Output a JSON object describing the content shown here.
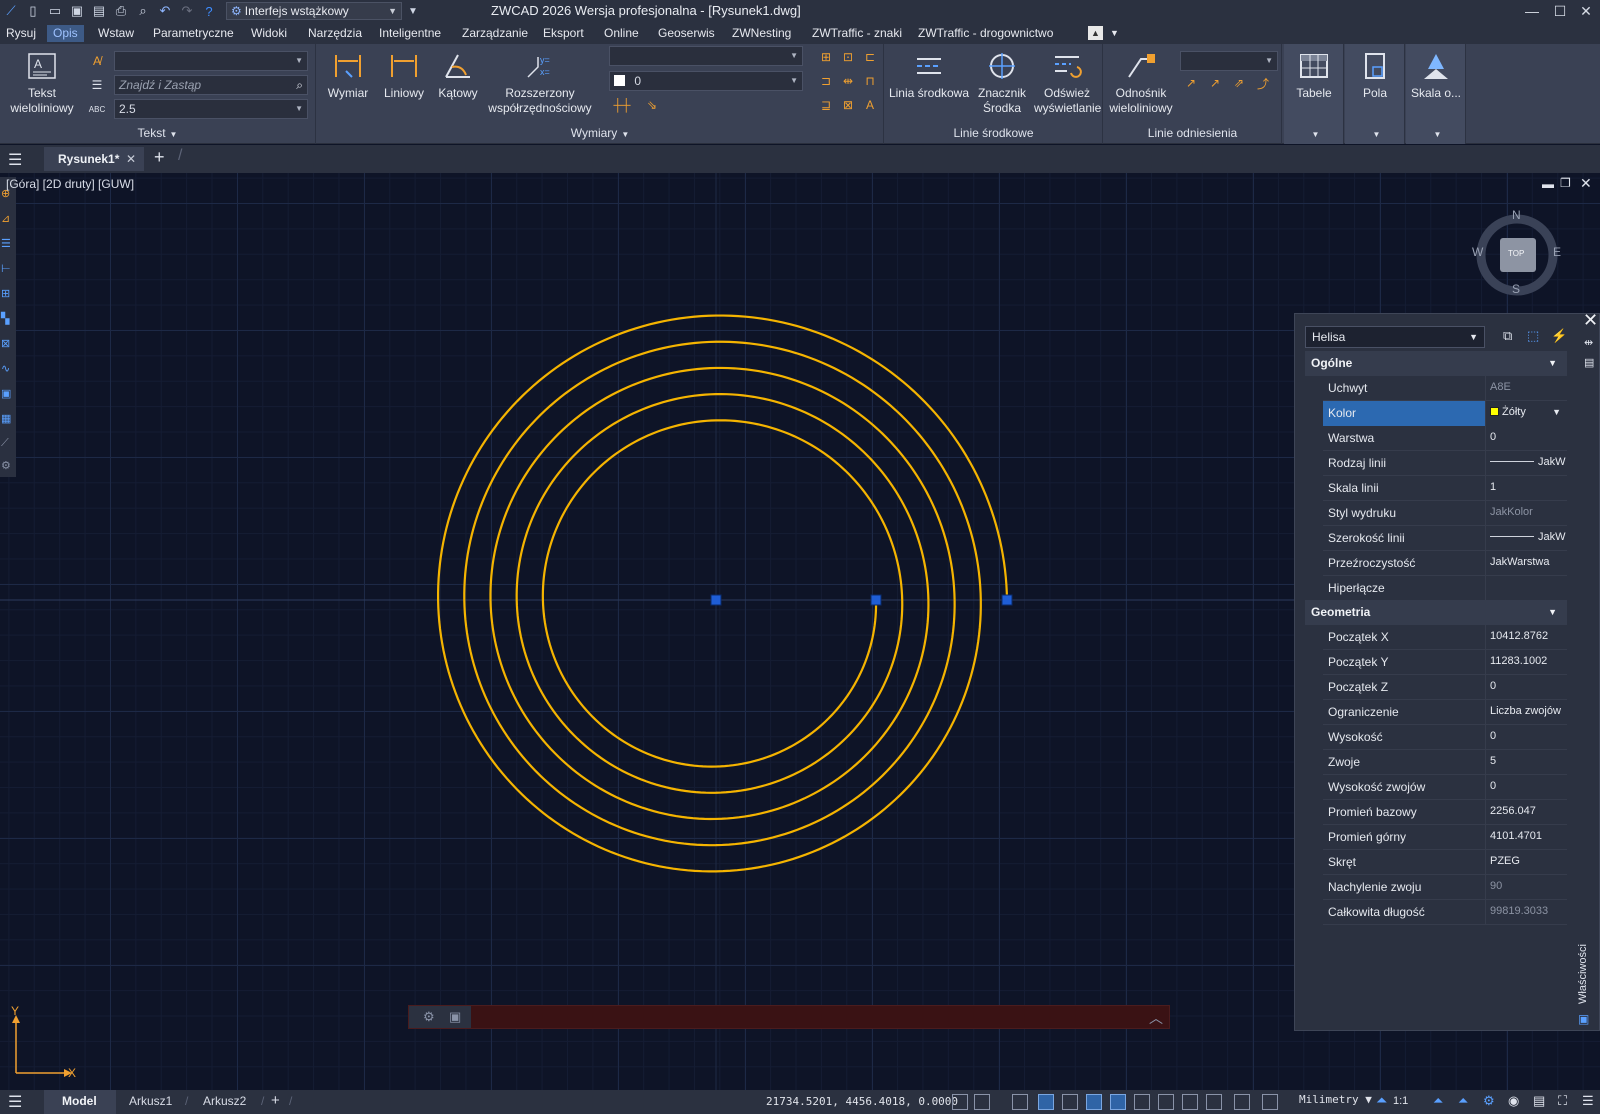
{
  "titlebar": {
    "workspace": "Interfejs wstążkowy",
    "title": "ZWCAD 2026 Wersja profesjonalna - [Rysunek1.dwg]"
  },
  "menu": [
    "Rysuj",
    "Opis",
    "Wstaw",
    "Parametryczne",
    "Widoki",
    "Narzędzia",
    "Inteligentne",
    "Zarządzanie",
    "Eksport",
    "Online",
    "Geoserwis",
    "ZWNesting",
    "ZWTraffic - znaki",
    "ZWTraffic - drogownictwo"
  ],
  "ribbon": {
    "text_panel": {
      "title": "Tekst",
      "mtext_label": "Tekst wieloliniowy",
      "find_placeholder": "Znajdź i Zastąp",
      "height_value": "2.5"
    },
    "dim_panel": {
      "title": "Wymiary",
      "buttons": [
        "Wymiar",
        "Liniowy",
        "Kątowy",
        "Rozszerzony współrzędnościowy"
      ],
      "layer_value": "0"
    },
    "center_panel": {
      "title": "Linie środkowe",
      "buttons": [
        "Linia środkowa",
        "Znacznik Środka",
        "Odśwież wyświetlanie"
      ]
    },
    "leader_panel": {
      "title": "Linie odniesienia",
      "button": "Odnośnik wieloliniowy"
    },
    "extra_buttons": [
      "Tabele",
      "Pola",
      "Skala o..."
    ]
  },
  "document_tab": "Rysunek1*",
  "viewport_label": "[Góra] [2D druty] [GUW]",
  "viewcube": {
    "n": "N",
    "s": "S",
    "e": "E",
    "w": "W",
    "face": "TOP"
  },
  "properties": {
    "object_type": "Helisa",
    "palette_title": "Właściwości",
    "general": {
      "title": "Ogólne",
      "rows": [
        {
          "name": "Uchwyt",
          "value": "A8E",
          "readonly": true
        },
        {
          "name": "Kolor",
          "value": "Żółty",
          "color": "#ffff00"
        },
        {
          "name": "Warstwa",
          "value": "0"
        },
        {
          "name": "Rodzaj linii",
          "value": "JakW"
        },
        {
          "name": "Skala linii",
          "value": "1"
        },
        {
          "name": "Styl wydruku",
          "value": "JakKolor",
          "readonly": true
        },
        {
          "name": "Szerokość linii",
          "value": "JakW"
        },
        {
          "name": "Przeźroczystość",
          "value": "JakWarstwa"
        },
        {
          "name": "Hiperłącze",
          "value": ""
        }
      ]
    },
    "geometry": {
      "title": "Geometria",
      "rows": [
        {
          "name": "Początek X",
          "value": "10412.8762"
        },
        {
          "name": "Początek Y",
          "value": "11283.1002"
        },
        {
          "name": "Początek Z",
          "value": "0"
        },
        {
          "name": "Ograniczenie",
          "value": "Liczba zwojów"
        },
        {
          "name": "Wysokość",
          "value": "0"
        },
        {
          "name": "Zwoje",
          "value": "5"
        },
        {
          "name": "Wysokość zwojów",
          "value": "0"
        },
        {
          "name": "Promień bazowy",
          "value": "2256.047"
        },
        {
          "name": "Promień górny",
          "value": "4101.4701"
        },
        {
          "name": "Skręt",
          "value": "PZEG"
        },
        {
          "name": "Nachylenie zwoju",
          "value": "90",
          "readonly": true
        },
        {
          "name": "Całkowita długość",
          "value": "99819.3033",
          "readonly": true
        }
      ]
    }
  },
  "ucs": {
    "x": "X",
    "y": "Y"
  },
  "statusbar": {
    "tabs": [
      "Model",
      "Arkusz1",
      "Arkusz2"
    ],
    "coords": "21734.5201, 4456.4018, 0.0000",
    "units": "Milimetry",
    "scale": "1:1"
  },
  "colors": {
    "helix": "#f5b400",
    "grip": "#1f5ed6",
    "accent": "#2c69b1"
  }
}
